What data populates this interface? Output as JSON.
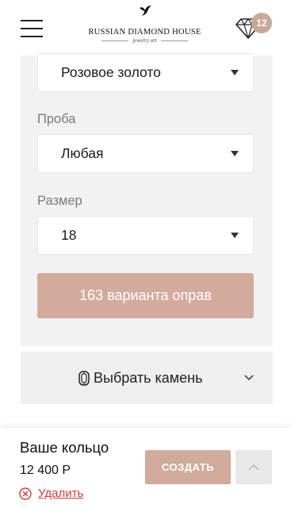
{
  "header": {
    "brand": "RUSSIAN DIAMOND HOUSE",
    "tagline": "jewelry art",
    "cart_count": "12",
    "icons": {
      "menu": "hamburger-menu-icon",
      "logo": "bird-logo-icon",
      "cart": "diamond-icon"
    }
  },
  "filters": {
    "metal_value": "Розовое золото",
    "proba_label": "Проба",
    "proba_value": "Любая",
    "size_label": "Размер",
    "size_value": "18",
    "variants_button": "163 варианта оправ"
  },
  "stone": {
    "label": "Выбрать камень",
    "icons": {
      "gem": "gem-icon",
      "toggle": "chevron-down-icon"
    }
  },
  "summary": {
    "title": "Ваше кольцо",
    "price": "12 400 Р",
    "remove_label": "Удалить",
    "create_button": "СОЗДАТЬ",
    "icons": {
      "remove": "remove-circle-x-icon",
      "scroll_up": "chevron-up-icon"
    }
  },
  "colors": {
    "accent": "#d3ab9c",
    "badge": "#c8a898",
    "panel_bg": "#f2f2f2",
    "danger": "#d53a3a"
  }
}
